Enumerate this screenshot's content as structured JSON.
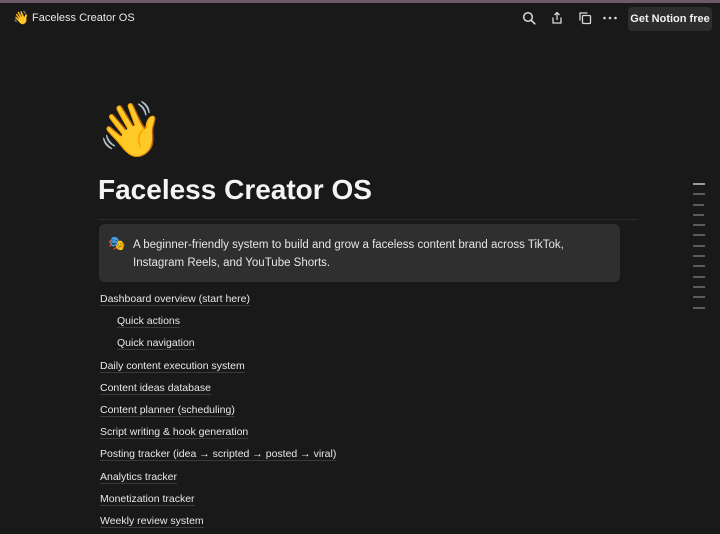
{
  "app": {
    "page_icon": "👋",
    "page_title": "Faceless Creator OS",
    "get_notion_label": "Get Notion free",
    "icons": [
      "search-icon",
      "share-icon",
      "duplicate-icon",
      "more-icon"
    ]
  },
  "page": {
    "hero_icon": "👋",
    "title": "Faceless Creator OS",
    "callout": {
      "icon": "🎭",
      "text": "A beginner-friendly system to build and grow a faceless content brand across TikTok, Instagram Reels, and YouTube Shorts."
    },
    "toc": [
      {
        "label": "Dashboard overview (start here)",
        "indent": false
      },
      {
        "label": "Quick actions",
        "indent": true
      },
      {
        "label": "Quick navigation",
        "indent": true
      },
      {
        "label": "Daily content execution system",
        "indent": false
      },
      {
        "label": "Content ideas database",
        "indent": false
      },
      {
        "label": "Content planner (scheduling)",
        "indent": false
      },
      {
        "label": "Script writing & hook generation",
        "indent": false
      },
      {
        "label": "Posting tracker (idea → scripted → posted → viral)",
        "indent": false
      },
      {
        "label": "Analytics tracker",
        "indent": false
      },
      {
        "label": "Monetization tracker",
        "indent": false
      },
      {
        "label": "Weekly review system",
        "indent": false
      }
    ]
  }
}
